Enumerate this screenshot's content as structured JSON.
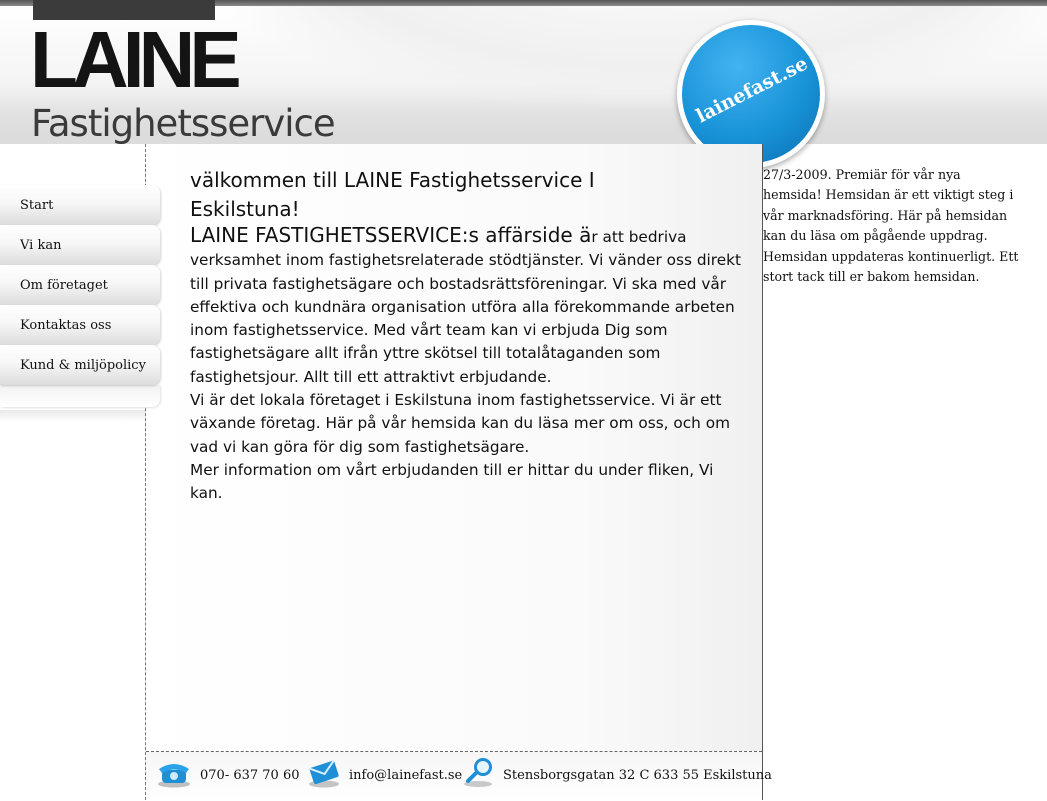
{
  "header": {
    "logo_main": "LAINE",
    "logo_sub": "Fastighetsservice",
    "badge_text": "lainefast.se"
  },
  "nav": {
    "items": [
      {
        "label": "Start"
      },
      {
        "label": "Vi kan"
      },
      {
        "label": "Om företaget"
      },
      {
        "label": "Kontaktas oss"
      },
      {
        "label": "Kund & miljöpolicy"
      }
    ]
  },
  "main": {
    "welcome_line1": "välkommen till LAINE Fastighetsservice I",
    "welcome_line2": "Eskilstuna!",
    "business_lead": "LAINE FASTIGHETSSERVICE:s affärside ä",
    "business_body": "r att bedriva verksamhet inom fastighetsrelaterade stödtjänster. Vi vänder oss direkt till privata fastighetsägare och bostadsrättsföreningar. Vi ska med vår effektiva och kundnära organisation utföra alla förekommande arbeten inom fastighetsservice. Med vårt team kan vi erbjuda Dig som fastighetsägare allt ifrån yttre skötsel till totalåtaganden som fastighetsjour. Allt till ett attraktivt erbjudande.",
    "local_text": "Vi är det lokala företaget i Eskilstuna inom fastighetsservice. Vi är ett växande företag. Här på  vår hemsida kan du läsa mer om oss, och om vad vi kan göra för dig som fastighetsägare.",
    "more_info": "Mer information om vårt erbjudanden till er hittar du under fliken, Vi kan."
  },
  "news": {
    "text": "27/3-2009. Premiär för vår nya hemsida! Hemsidan är ett viktigt steg i vår marknadsföring. Här på hemsidan kan du läsa om pågående uppdrag. Hemsidan uppdateras kontinuerligt. Ett stort tack till er bakom hemsidan."
  },
  "footer": {
    "phone": "070- 637 70 60",
    "email": "info@lainefast.se",
    "address": "Stensborgsgatan 32 C 633 55 Eskilstuna",
    "phone_icon": "phone-icon",
    "email_icon": "envelope-icon",
    "address_icon": "magnifier-icon"
  },
  "colors": {
    "badge_blue": "#1893d8",
    "text": "#111111",
    "icon_blue": "#1f8fd6"
  }
}
